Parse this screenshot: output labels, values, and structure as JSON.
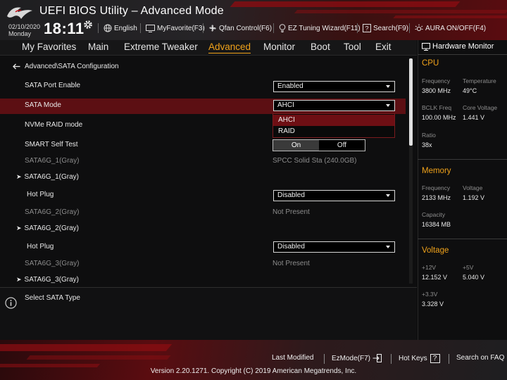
{
  "header": {
    "title": "UEFI BIOS Utility – Advanced Mode",
    "date": "02/10/2020",
    "weekday": "Monday",
    "time": "18:11",
    "items": {
      "language": "English",
      "myfavorite": "MyFavorite(F3)",
      "qfan": "Qfan Control(F6)",
      "ez_tuning": "EZ Tuning Wizard(F11)",
      "search": "Search(F9)",
      "aura": "AURA ON/OFF(F4)"
    }
  },
  "menu": {
    "tabs": [
      "My Favorites",
      "Main",
      "Extreme Tweaker",
      "Advanced",
      "Monitor",
      "Boot",
      "Tool",
      "Exit"
    ],
    "active": "Advanced"
  },
  "content": {
    "breadcrumb": "Advanced\\SATA Configuration",
    "sata_port_enable": {
      "label": "SATA Port Enable",
      "value": "Enabled"
    },
    "sata_mode": {
      "label": "SATA Mode",
      "value": "AHCI"
    },
    "dropdown_options": [
      "AHCI",
      "RAID"
    ],
    "nvme_raid": {
      "label": "NVMe RAID mode"
    },
    "smart_self_test": {
      "label": "SMART Self Test",
      "on": "On",
      "off": "Off"
    },
    "sata6g_1": {
      "label": "SATA6G_1(Gray)",
      "value": "SPCC Solid Sta (240.0GB)",
      "sub": "SATA6G_1(Gray)"
    },
    "hot_plug_1": {
      "label": "Hot Plug",
      "value": "Disabled"
    },
    "sata6g_2": {
      "label": "SATA6G_2(Gray)",
      "value": "Not Present",
      "sub": "SATA6G_2(Gray)"
    },
    "hot_plug_2": {
      "label": "Hot Plug",
      "value": "Disabled"
    },
    "sata6g_3": {
      "label": "SATA6G_3(Gray)",
      "value": "Not Present",
      "sub": "SATA6G_3(Gray)"
    }
  },
  "help": {
    "text": "Select SATA Type"
  },
  "hw_monitor": {
    "title": "Hardware Monitor",
    "cpu": {
      "heading": "CPU",
      "frequency_label": "Frequency",
      "frequency": "3800 MHz",
      "temperature_label": "Temperature",
      "temperature": "49°C",
      "bclk_label": "BCLK Freq",
      "bclk": "100.00 MHz",
      "core_voltage_label": "Core Voltage",
      "core_voltage": "1.441 V",
      "ratio_label": "Ratio",
      "ratio": "38x"
    },
    "memory": {
      "heading": "Memory",
      "frequency_label": "Frequency",
      "frequency": "2133 MHz",
      "voltage_label": "Voltage",
      "voltage": "1.192 V",
      "capacity_label": "Capacity",
      "capacity": "16384 MB"
    },
    "voltage": {
      "heading": "Voltage",
      "v12_label": "+12V",
      "v12": "12.152 V",
      "v5_label": "+5V",
      "v5": "5.040 V",
      "v33_label": "+3.3V",
      "v33": "3.328 V"
    }
  },
  "footer": {
    "last_modified": "Last Modified",
    "ezmode": "EzMode(F7)",
    "hotkeys": "Hot Keys",
    "hotkeys_key": "?",
    "search_faq": "Search on FAQ",
    "copyright": "Version 2.20.1271. Copyright (C) 2019 American Megatrends, Inc."
  },
  "colors": {
    "accent": "#f0a21a",
    "highlight_row": "#5c0f13",
    "brand_red": "#8a0d12"
  }
}
